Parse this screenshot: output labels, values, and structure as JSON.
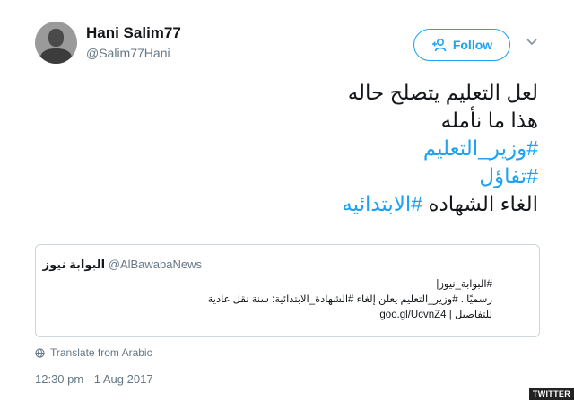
{
  "author": {
    "name": "Hani Salim77",
    "handle": "@Salim77Hani",
    "follow_label": "Follow"
  },
  "tweet": {
    "line1": "لعل التعليم يتصلح حاله",
    "line2": "هذا ما نأمله",
    "line3_hashtag": "#وزير_التعليم",
    "line4_hashtag": "#تفاؤل",
    "line5_text": "الغاء الشهاده ",
    "line5_hashtag": "#الابتدائيه"
  },
  "quoted_tweet": {
    "name": "البوابة نيوز",
    "handle": "@AlBawabaNews",
    "line1": "#البوابة_نيوز|",
    "line2": "رسميًا.. #وزير_التعليم يعلن إلغاء #الشهادة_الابتدائية: سنة نقل عادية",
    "line3_text": "للتفاصيل | ",
    "line3_link": "goo.gl/UcvnZ4"
  },
  "translate_label": "Translate from Arabic",
  "timestamp": "12:30 pm - 1 Aug 2017",
  "watermark": "TWITTER",
  "colors": {
    "accent": "#1da1f2",
    "secondary_text": "#657786",
    "border": "#ccd6dd"
  }
}
